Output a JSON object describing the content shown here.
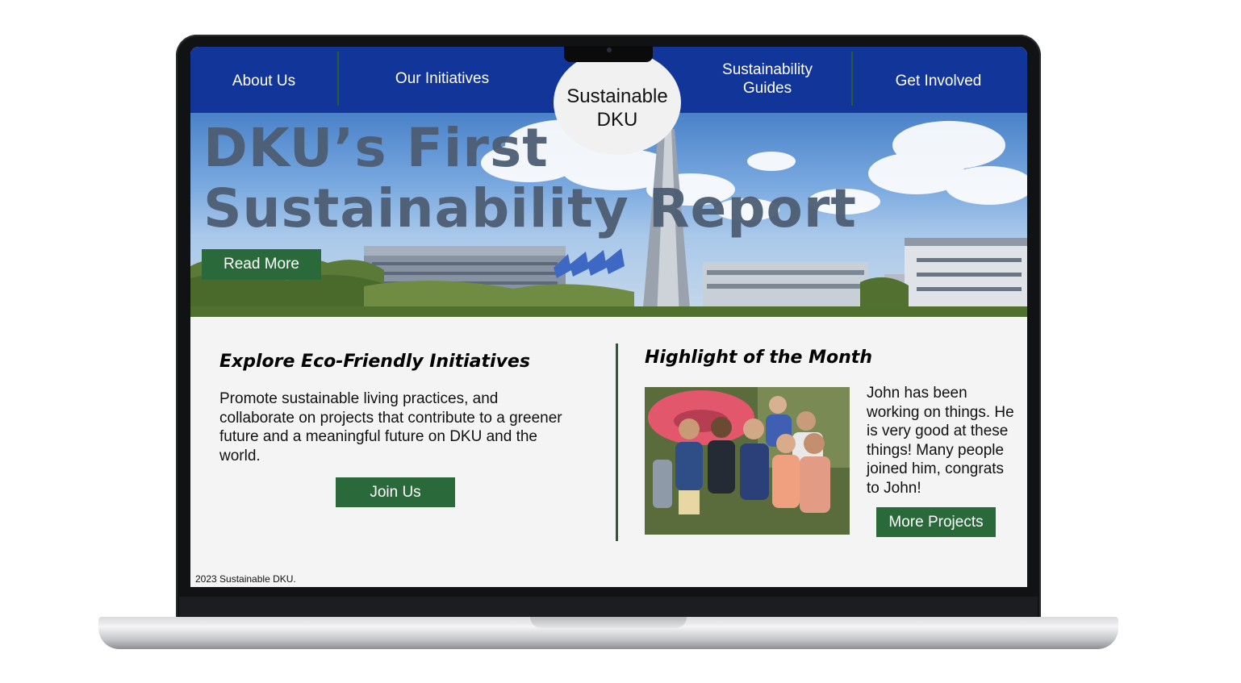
{
  "nav": {
    "about": "About Us",
    "initiatives": "Our Initiatives",
    "logo": "Sustainable\nDKU",
    "guides": "Sustainability\nGuides",
    "involved": "Get Involved"
  },
  "hero": {
    "title": "DKU’s First\nSustainability Report",
    "read_more": "Read More"
  },
  "explore": {
    "title": "Explore Eco-Friendly Initiatives",
    "text": "Promote sustainable living practices, and collaborate on projects that contribute to a greener future and a meaningful future on DKU and the world.",
    "join_button": "Join Us"
  },
  "highlight": {
    "title": "Highlight of the Month",
    "text": "John has been working on things. He is very good at these things! Many people joined him, congrats to John!",
    "more_button": "More Projects"
  },
  "footer": {
    "text": "2023 Sustainable DKU."
  },
  "colors": {
    "nav_blue": "#12359a",
    "button_green": "#2a6a3a",
    "divider_green": "#2a5a36",
    "content_bg": "#f4f4f4"
  }
}
